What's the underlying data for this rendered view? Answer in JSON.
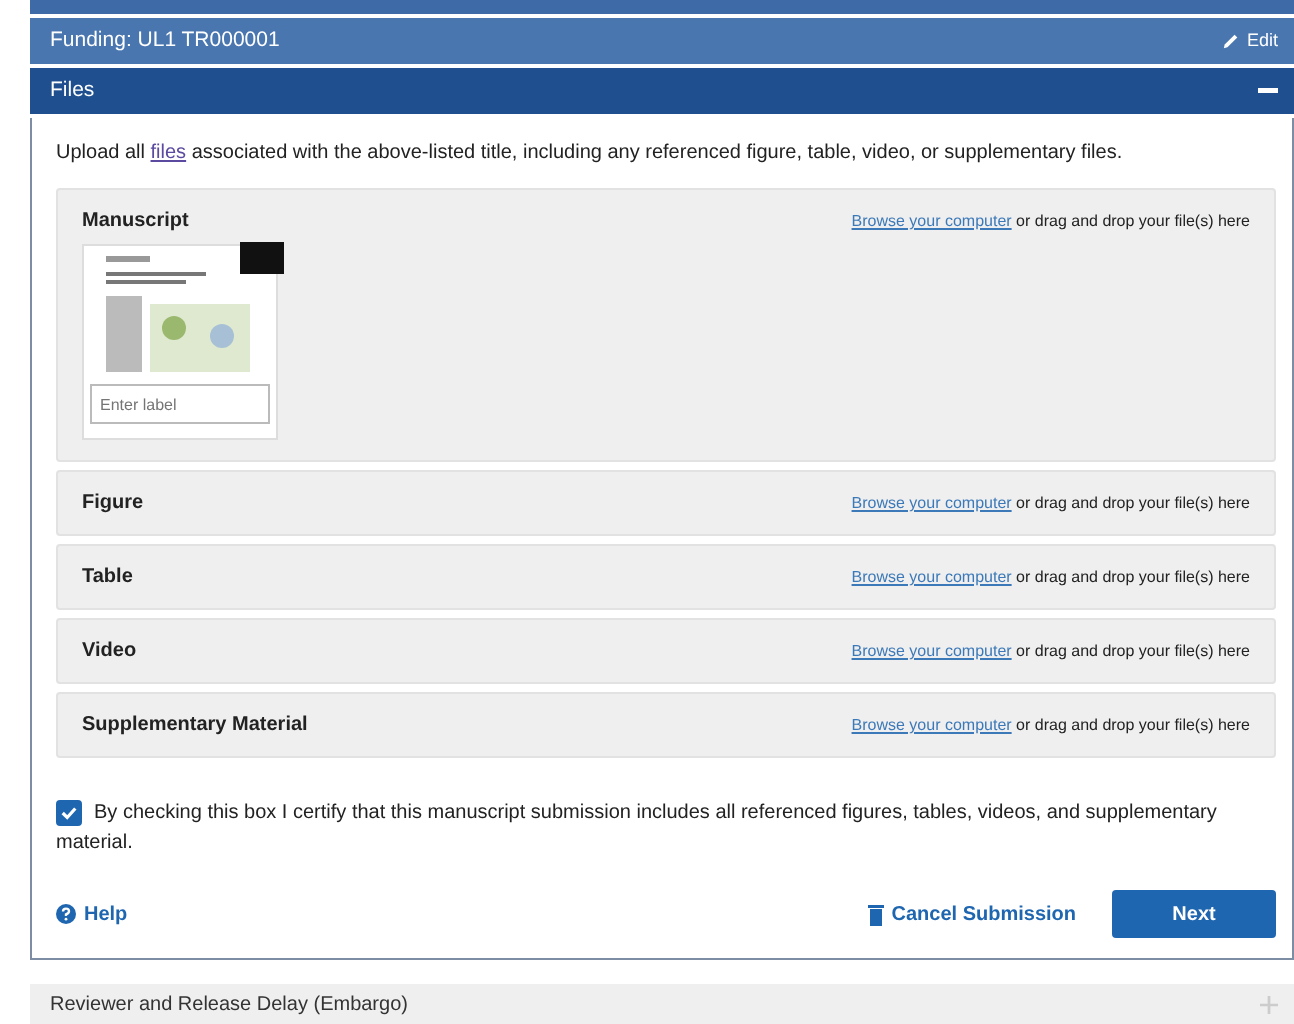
{
  "funding_bar": {
    "title": "Funding: UL1 TR000001",
    "action": "Edit"
  },
  "files_section": {
    "title": "Files",
    "expanded": true,
    "intro_before": "Upload all ",
    "intro_link": "files",
    "intro_after": " associated with the above-listed title, including any referenced figure, table, video, or supplementary files.",
    "upload_groups": [
      {
        "label": "Manuscript",
        "browse_link": "Browse your computer",
        "drop_text": "or drag and drop your file(s) here",
        "files": [
          {
            "label_placeholder": "Enter label"
          }
        ]
      },
      {
        "label": "Figure",
        "browse_link": "Browse your computer",
        "drop_text": "or drag and drop your file(s) here"
      },
      {
        "label": "Table",
        "browse_link": "Browse your computer",
        "drop_text": "or drag and drop your file(s) here"
      },
      {
        "label": "Video",
        "browse_link": "Browse your computer",
        "drop_text": "or drag and drop your file(s) here"
      },
      {
        "label": "Supplementary Material",
        "browse_link": "Browse your computer",
        "drop_text": "or drag and drop your file(s) here"
      }
    ],
    "certify": {
      "checked": true,
      "text": "By checking this box I certify that this manuscript submission includes all referenced figures, tables, videos, and supplementary material."
    },
    "help": "Help",
    "cancel": "Cancel Submission",
    "next": "Next"
  },
  "next_section": {
    "title": "Reviewer and Release Delay (Embargo)",
    "expanded": false
  }
}
